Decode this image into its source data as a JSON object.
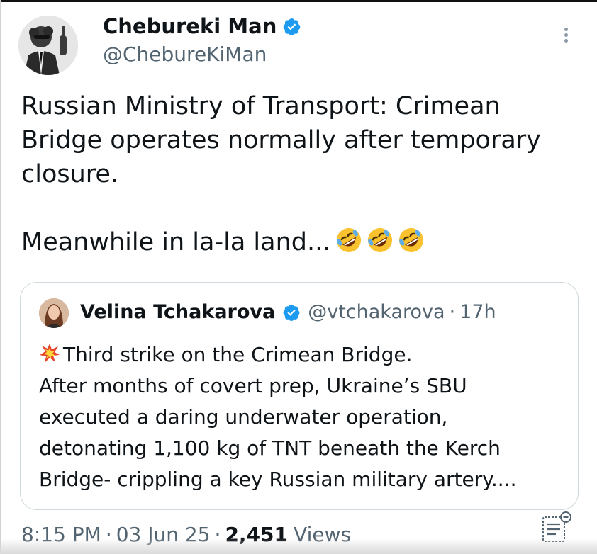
{
  "tweet": {
    "author": {
      "name": "Chebureki Man",
      "handle": "@ChebureKiMan",
      "verified": true
    },
    "text_lines": [
      "Russian Ministry of Transport: Crimean",
      "Bridge operates normally after temporary",
      "closure."
    ],
    "text_line_2": "Meanwhile in la-la land...",
    "emojis": [
      "rolling-on-floor-laughing",
      "rolling-on-floor-laughing",
      "rolling-on-floor-laughing"
    ],
    "quote": {
      "name": "Velina Tchakarova",
      "handle": "@vtchakarova",
      "time": "17h",
      "emoji": "collision",
      "lines": [
        "Third strike on the Crimean Bridge.",
        "After months of covert prep, Ukraine’s SBU",
        "executed a daring underwater operation,",
        "detonating 1,100 kg of TNT beneath the Kerch",
        "Bridge- crippling a key Russian military artery...."
      ]
    },
    "meta": {
      "time": "8:15 PM",
      "date": "03 Jun 25",
      "views_count": "2,451",
      "views_label": "Views",
      "separator": "·"
    }
  },
  "colors": {
    "verified_blue": "#1d9bf0",
    "secondary_text": "#536471",
    "border": "#cfd9de"
  },
  "icons": {
    "more": "more-vertical-icon",
    "verified": "verified-badge-icon",
    "note": "community-note-icon"
  }
}
